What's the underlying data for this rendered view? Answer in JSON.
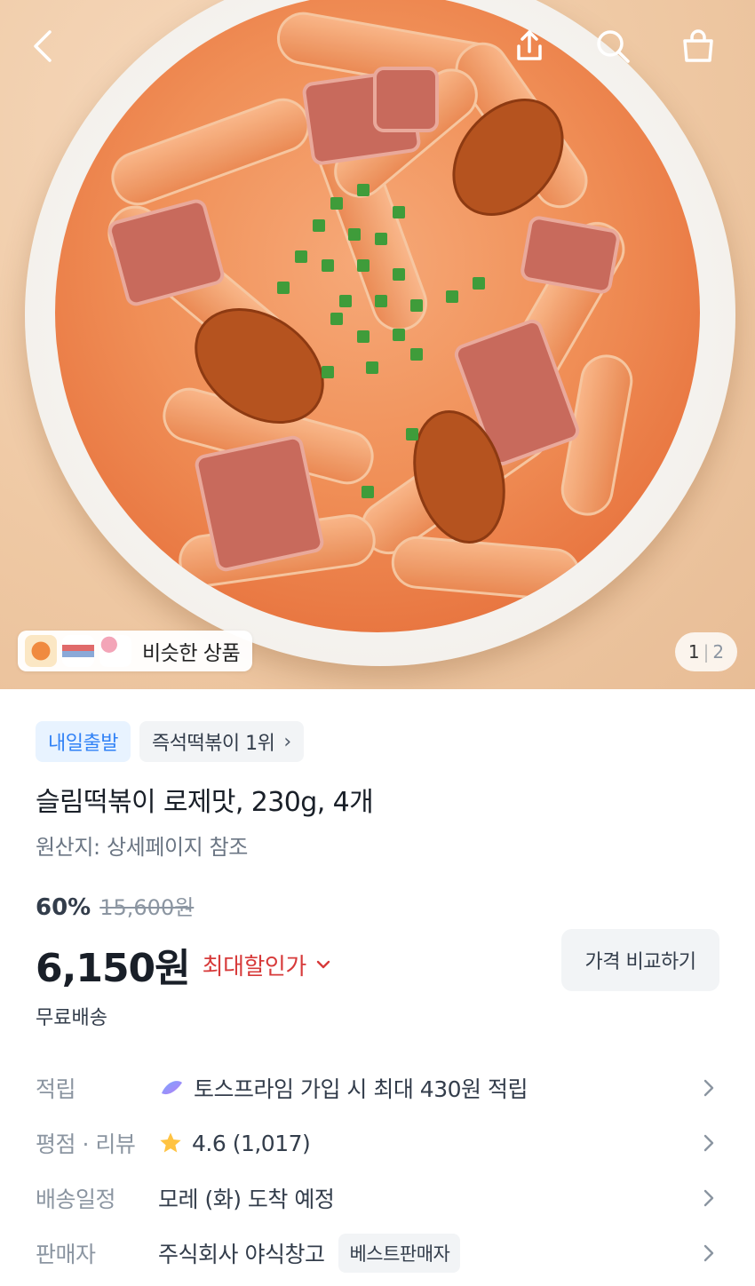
{
  "gallery": {
    "current": "1",
    "total": "2",
    "similar_label": "비슷한 상품"
  },
  "icons": {
    "back": "chevron-left-icon",
    "share": "share-icon",
    "search": "search-icon",
    "cart": "shopping-bag-icon"
  },
  "tags": {
    "delivery": "내일출발",
    "ranking": "즉석떡볶이 1위"
  },
  "product": {
    "title": "슬림떡볶이 로제맛, 230g, 4개",
    "origin": "원산지: 상세페이지 참조",
    "discount": "60%",
    "original_price": "15,600원",
    "price": "6,150원",
    "max_discount_label": "최대할인가",
    "compare_label": "가격 비교하기",
    "shipping": "무료배송"
  },
  "details": [
    {
      "key": "적립",
      "value": "토스프라임 가입 시 최대 430원 적립",
      "icon": "toss-prime-icon"
    },
    {
      "key": "평점 · 리뷰",
      "value": "4.6 (1,017)",
      "icon": "star-icon"
    },
    {
      "key": "배송일정",
      "value": "모레 (화) 도착 예정"
    },
    {
      "key": "판매자",
      "value": "주식회사 야식창고",
      "badge": "베스트판매자"
    }
  ],
  "colors": {
    "blue": "#3182f6",
    "red": "#d73a3a",
    "star": "#ffc342"
  }
}
